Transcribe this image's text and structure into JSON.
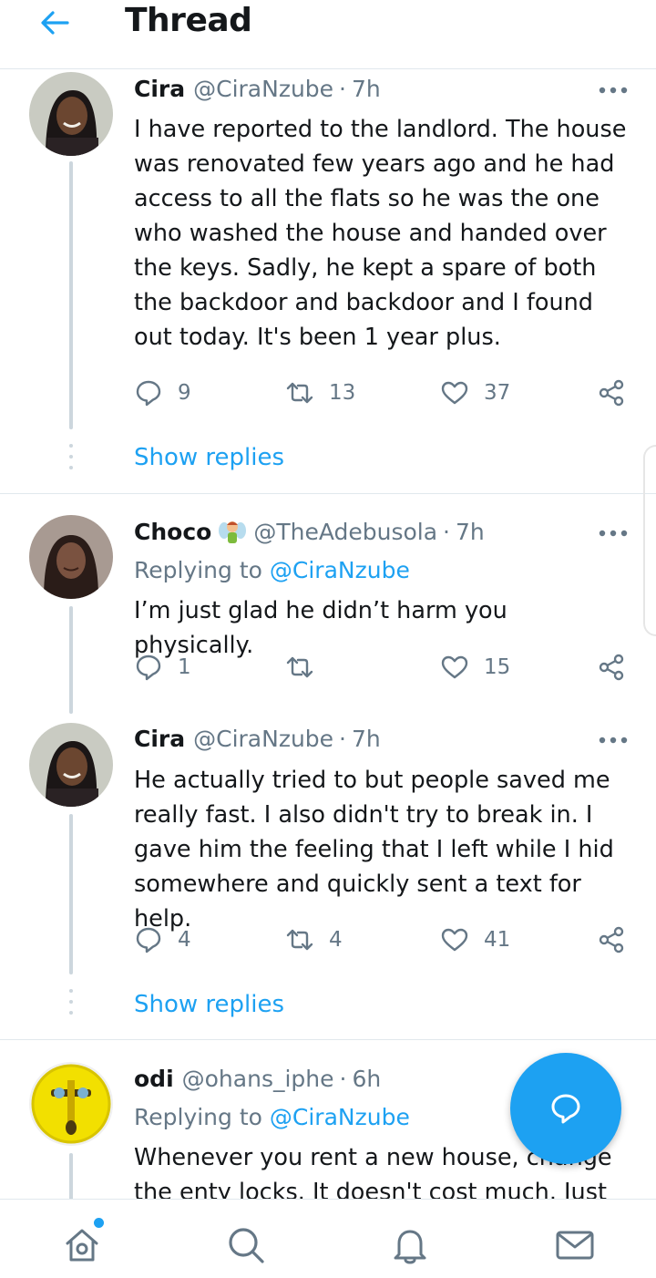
{
  "header": {
    "title": "Thread"
  },
  "colors": {
    "accent": "#1da1f2",
    "muted": "#657786",
    "text": "#14171a"
  },
  "tweets": [
    {
      "name": "Cira",
      "handle": "@CiraNzube",
      "time": "7h",
      "text": "I have reported to the landlord. The house was renovated few years ago and he had access to all the flats so he was the one who washed the house and handed over the keys. Sadly, he kept a spare of both the backdoor and backdoor and I found out today. It's been 1 year plus.",
      "replies": "9",
      "retweets": "13",
      "likes": "37",
      "show_replies": "Show replies"
    },
    {
      "name": "Choco",
      "handle": "@TheAdebusola",
      "time": "7h",
      "replying_prefix": "Replying to",
      "replying_to": "@CiraNzube",
      "text": "I’m just glad he didn’t harm you physically.",
      "replies": "1",
      "retweets": "",
      "likes": "15"
    },
    {
      "name": "Cira",
      "handle": "@CiraNzube",
      "time": "7h",
      "text": "He actually tried to but people saved me really fast. I also didn't try to break in. I gave him the feeling that I left while I hid somewhere and quickly sent a text for help.",
      "replies": "4",
      "retweets": "4",
      "likes": "41",
      "show_replies": "Show replies"
    },
    {
      "name": "odi",
      "handle": "@ohans_iphe",
      "time": "6h",
      "replying_prefix": "Replying to",
      "replying_to": "@CiraNzube",
      "text": "Whenever you rent a new house, change the enty locks. It doesn't cost much. Just"
    }
  ],
  "icons": {
    "back": "arrow-left-icon",
    "more": "more-dots-icon",
    "reply": "reply-bubble-icon",
    "retweet": "retweet-icon",
    "like": "heart-icon",
    "share": "share-icon",
    "compose": "compose-reply-icon",
    "home": "home-icon",
    "search": "search-icon",
    "notifications": "bell-icon",
    "messages": "mail-icon"
  }
}
